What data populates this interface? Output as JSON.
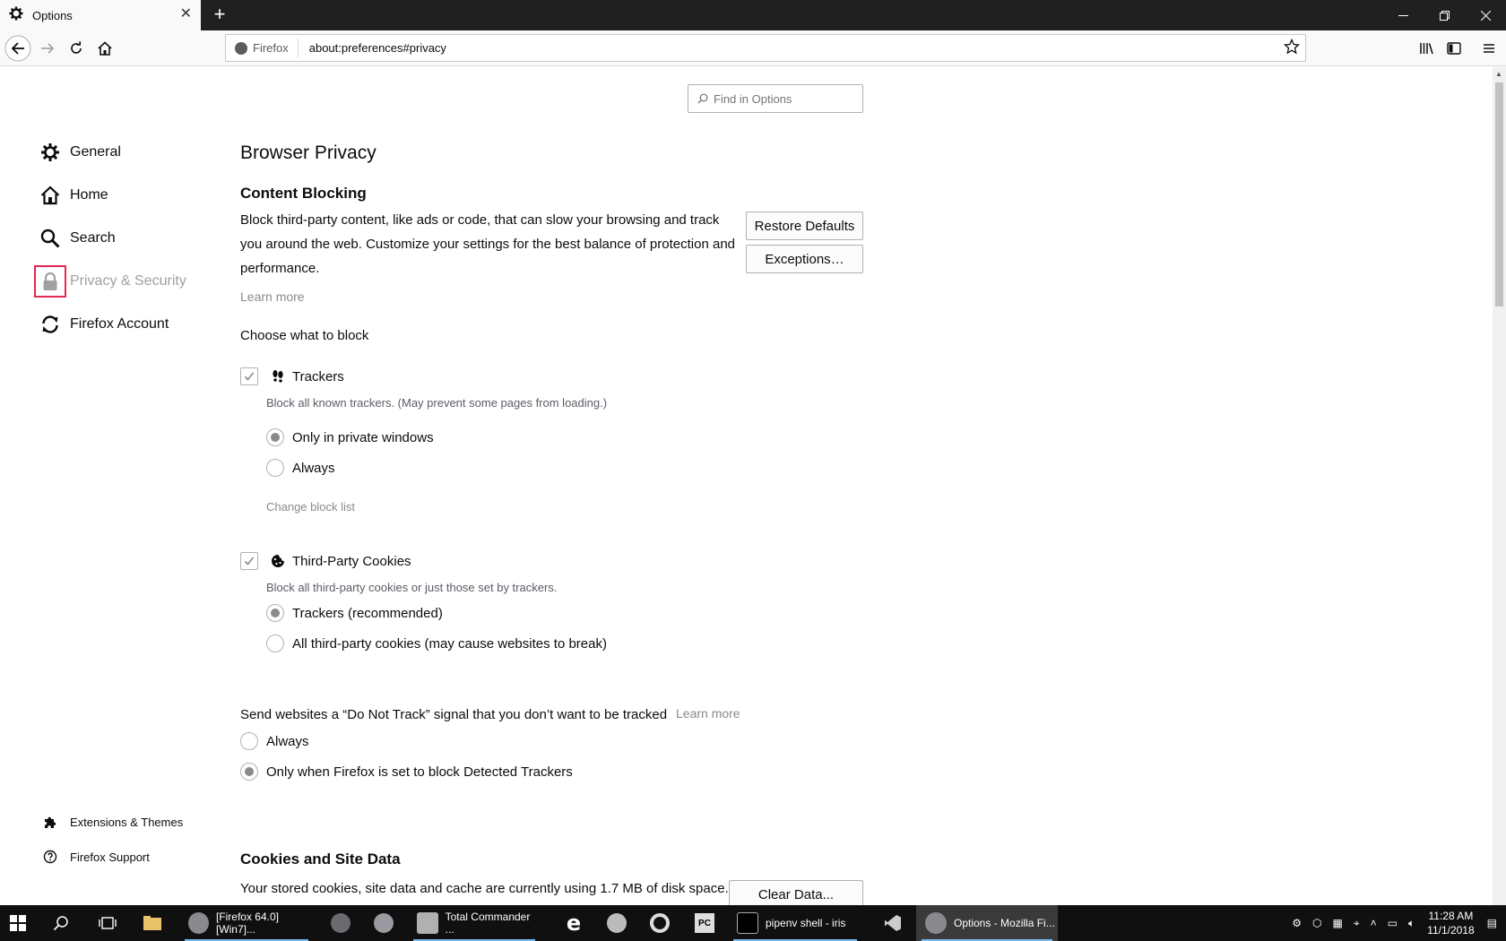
{
  "browser": {
    "tab_title": "Options",
    "tab_close": "✕",
    "new_tab": "+",
    "identity_label": "Firefox",
    "url": "about:preferences#privacy"
  },
  "search": {
    "placeholder": "Find in Options"
  },
  "sidebar": {
    "items": [
      {
        "label": "General",
        "icon": "gear-icon"
      },
      {
        "label": "Home",
        "icon": "home-icon"
      },
      {
        "label": "Search",
        "icon": "search-icon"
      },
      {
        "label": "Privacy & Security",
        "icon": "lock-icon",
        "selected": true
      },
      {
        "label": "Firefox Account",
        "icon": "sync-icon"
      }
    ],
    "footer": [
      {
        "label": "Extensions & Themes",
        "icon": "puzzle-icon"
      },
      {
        "label": "Firefox Support",
        "icon": "help-icon"
      }
    ]
  },
  "main": {
    "title": "Browser Privacy",
    "content_blocking": {
      "heading": "Content Blocking",
      "description_lines": [
        "Block third-party content, like ads or code, that can slow your browsing and track",
        "you around the web. Customize your settings for the best balance of protection and",
        "performance."
      ],
      "learn_more": "Learn more",
      "restore_defaults": "Restore Defaults",
      "exceptions": "Exceptions…",
      "choose_label": "Choose what to block",
      "trackers": {
        "label": "Trackers",
        "checked": true,
        "description": "Block all known trackers. (May prevent some pages from loading.)",
        "options": [
          {
            "label": "Only in private windows",
            "selected": true
          },
          {
            "label": "Always",
            "selected": false
          }
        ],
        "change_block_list": "Change block list"
      },
      "cookies": {
        "label": "Third-Party Cookies",
        "checked": true,
        "description": "Block all third-party cookies or just those set by trackers.",
        "options": [
          {
            "label": "Trackers (recommended)",
            "selected": true
          },
          {
            "label": "All third-party cookies (may cause websites to break)",
            "selected": false
          }
        ]
      }
    },
    "dnt": {
      "label": "Send websites a “Do Not Track” signal that you don’t want to be tracked",
      "learn_more": "Learn more",
      "options": [
        {
          "label": "Always",
          "selected": false
        },
        {
          "label": "Only when Firefox is set to block Detected Trackers",
          "selected": true
        }
      ]
    },
    "cookies_site_data": {
      "heading": "Cookies and Site Data",
      "description": "Your stored cookies, site data and cache are currently using 1.7 MB of disk space.",
      "clear_data": "Clear Data..."
    }
  },
  "taskbar": {
    "items": [
      {
        "label": "[Firefox 64.0][Win7]..."
      },
      {
        "label": "Total Commander ..."
      },
      {
        "label": "pipenv  shell - iris"
      },
      {
        "label": "Options - Mozilla Fi..."
      }
    ],
    "clock_time": "11:28 AM",
    "clock_date": "11/1/2018"
  },
  "colors": {
    "accent": "#0a84ff",
    "focus_outline": "#e22850",
    "titlebar": "#202020",
    "taskbar": "#101010"
  }
}
